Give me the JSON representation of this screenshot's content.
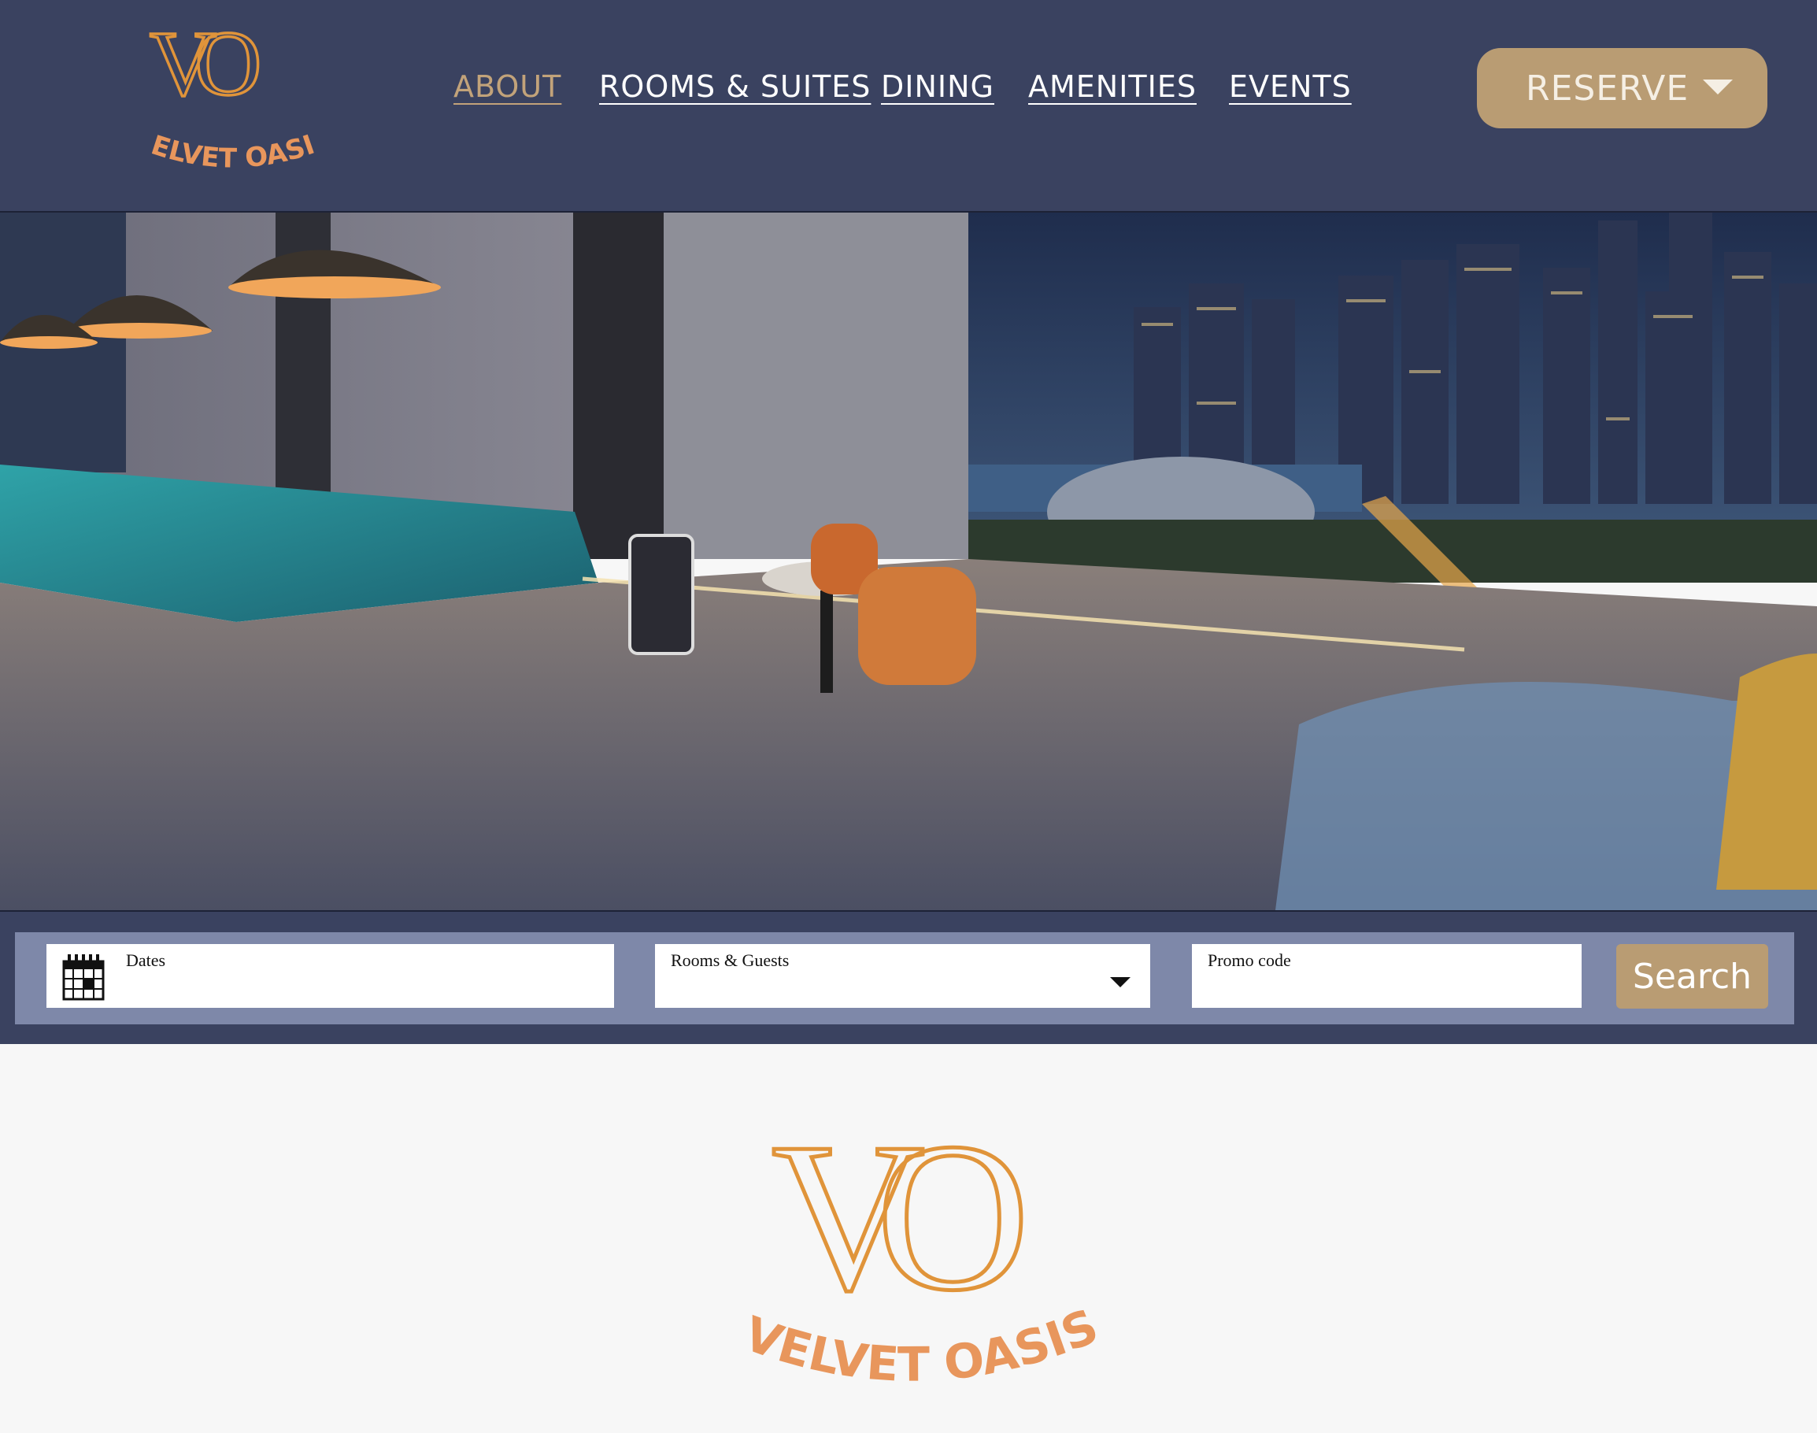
{
  "brand": {
    "monogram": "VO",
    "name": "VELVET OASIS",
    "colors": {
      "monogram": "#e0943a",
      "wordmark": "#e8965c",
      "header_bg": "#3a4260",
      "accent": "#b99c73"
    }
  },
  "nav": {
    "items": [
      {
        "label": "ABOUT",
        "active": true
      },
      {
        "label": "ROOMS & SUITES",
        "active": false
      },
      {
        "label": "DINING",
        "active": false
      },
      {
        "label": "AMENITIES",
        "active": false
      },
      {
        "label": "EVENTS",
        "active": false
      }
    ],
    "reserve_label": "RESERVE"
  },
  "hero": {
    "image": "rooftop-pool-terrace-city-skyline-night"
  },
  "booking": {
    "dates_label": "Dates",
    "dates_icon": "calendar-icon",
    "rooms_label": "Rooms & Guests",
    "rooms_icon": "chevron-down-icon",
    "promo_label": "Promo code",
    "search_label": "Search"
  }
}
